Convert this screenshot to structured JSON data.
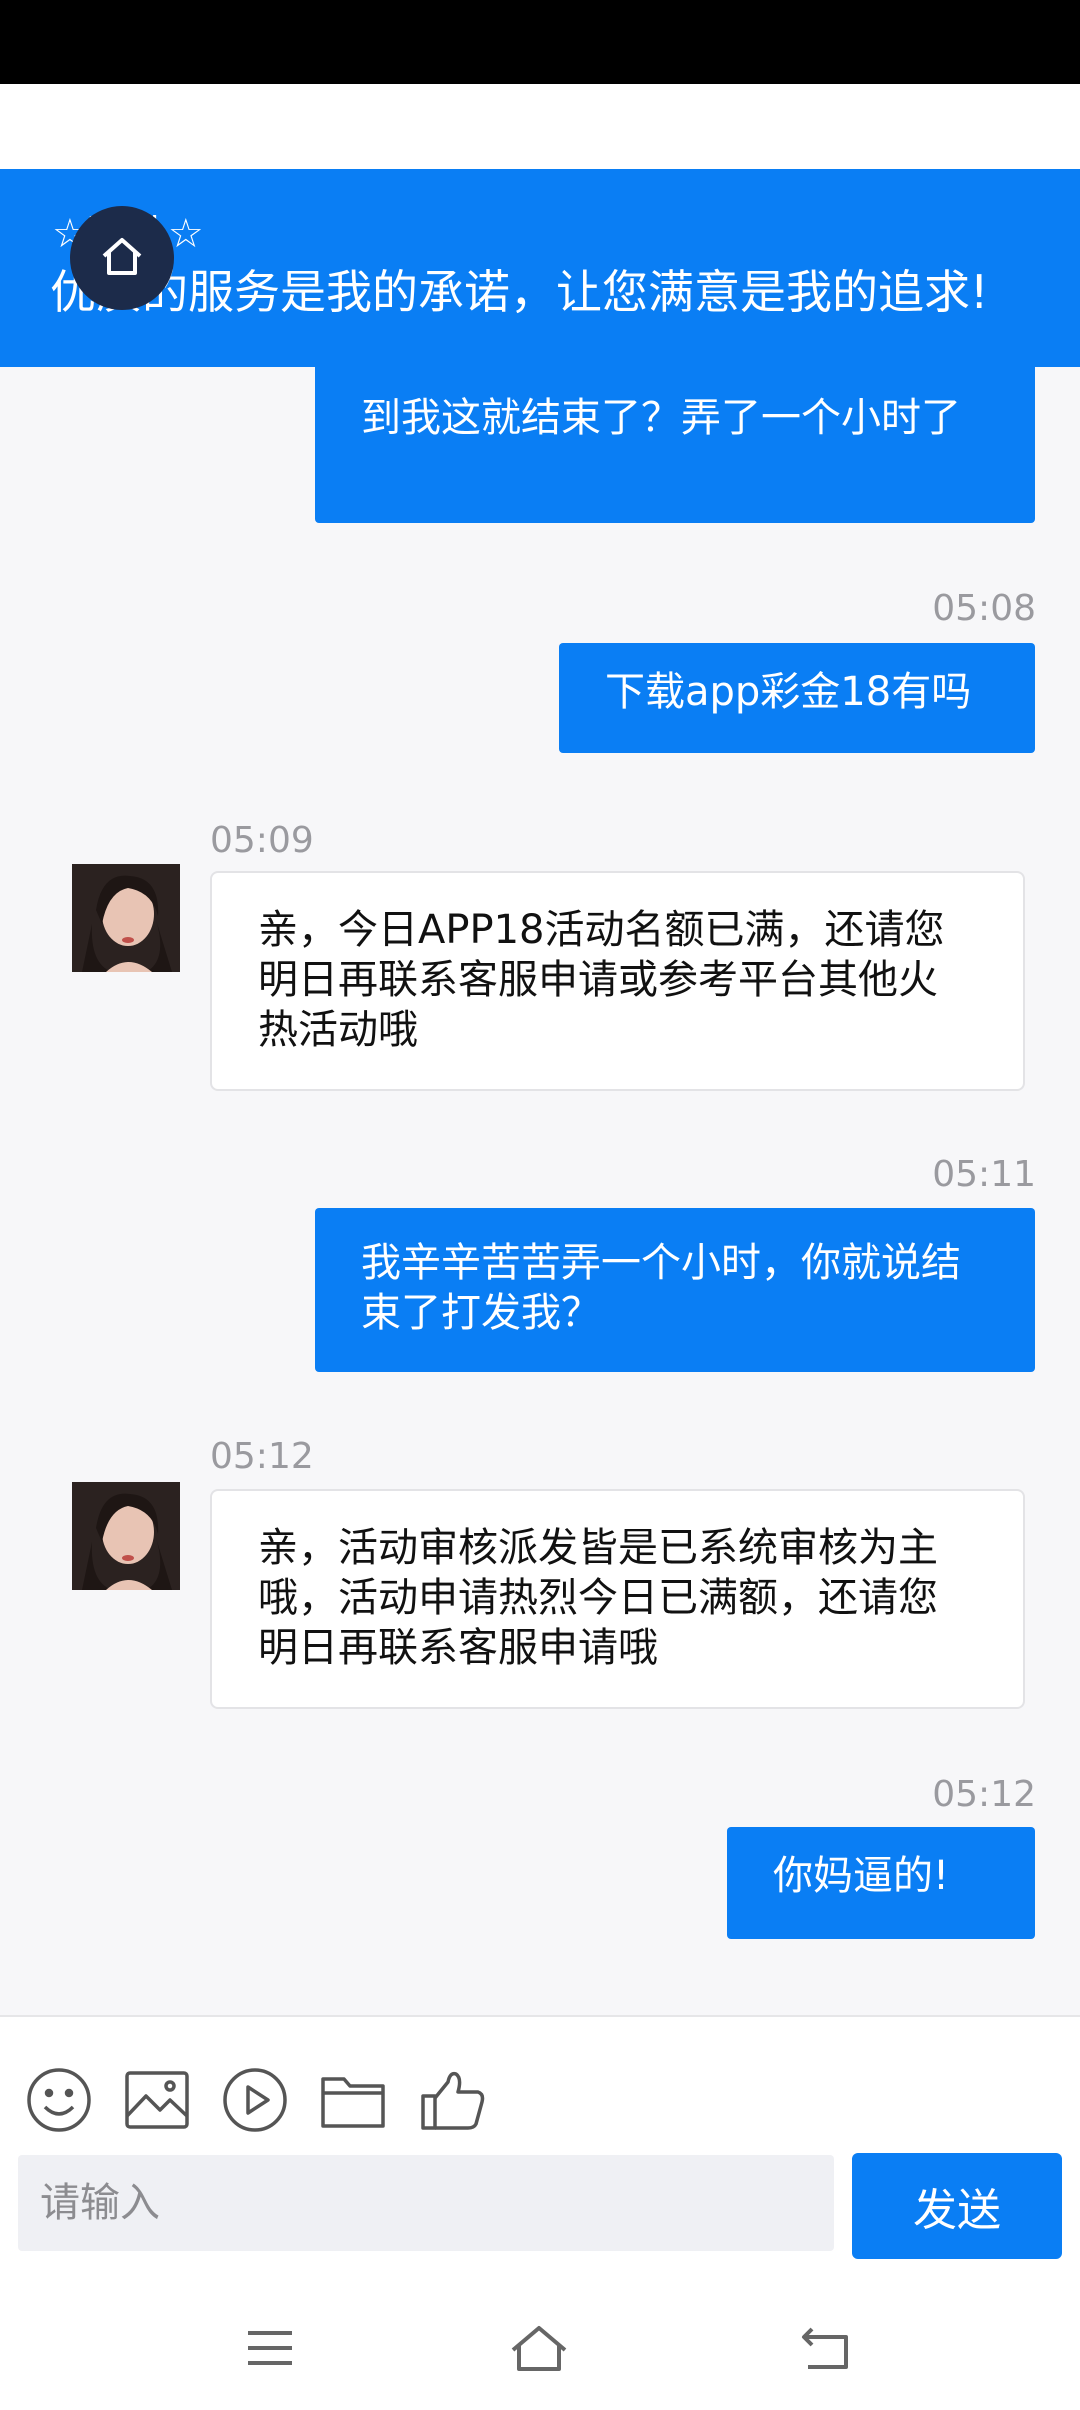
{
  "header": {
    "agent_name": "☆玥儿☆",
    "slogan": "优质的服务是我的承诺，让您满意是我的追求!"
  },
  "messages": [
    {
      "direction": "out",
      "text": "到我这就结束了？弄了一个小时了"
    },
    {
      "direction": "out",
      "time": "05:08",
      "text": "下载app彩金18有吗"
    },
    {
      "direction": "in",
      "time": "05:09",
      "text": "亲，今日APP18活动名额已满，还请您明日再联系客服申请或参考平台其他火热活动哦"
    },
    {
      "direction": "out",
      "time": "05:11",
      "text": "我辛辛苦苦弄一个小时，你就说结束了打发我？"
    },
    {
      "direction": "in",
      "time": "05:12",
      "text": "亲，活动审核派发皆是已系统审核为主哦，活动申请热烈今日已满额，还请您明日再联系客服申请哦"
    },
    {
      "direction": "out",
      "time": "05:12",
      "text": "你妈逼的!"
    }
  ],
  "composer": {
    "tools": [
      "emoji-icon",
      "image-icon",
      "video-icon",
      "folder-icon",
      "thumbs-up-icon"
    ],
    "input_placeholder": "请输入",
    "send_label": "发送"
  },
  "navbar": [
    "menu-icon",
    "home-icon",
    "back-icon"
  ],
  "colors": {
    "accent": "#0a7ef4",
    "background": "#f7f7f9",
    "timestamp": "#9a9a9f"
  }
}
